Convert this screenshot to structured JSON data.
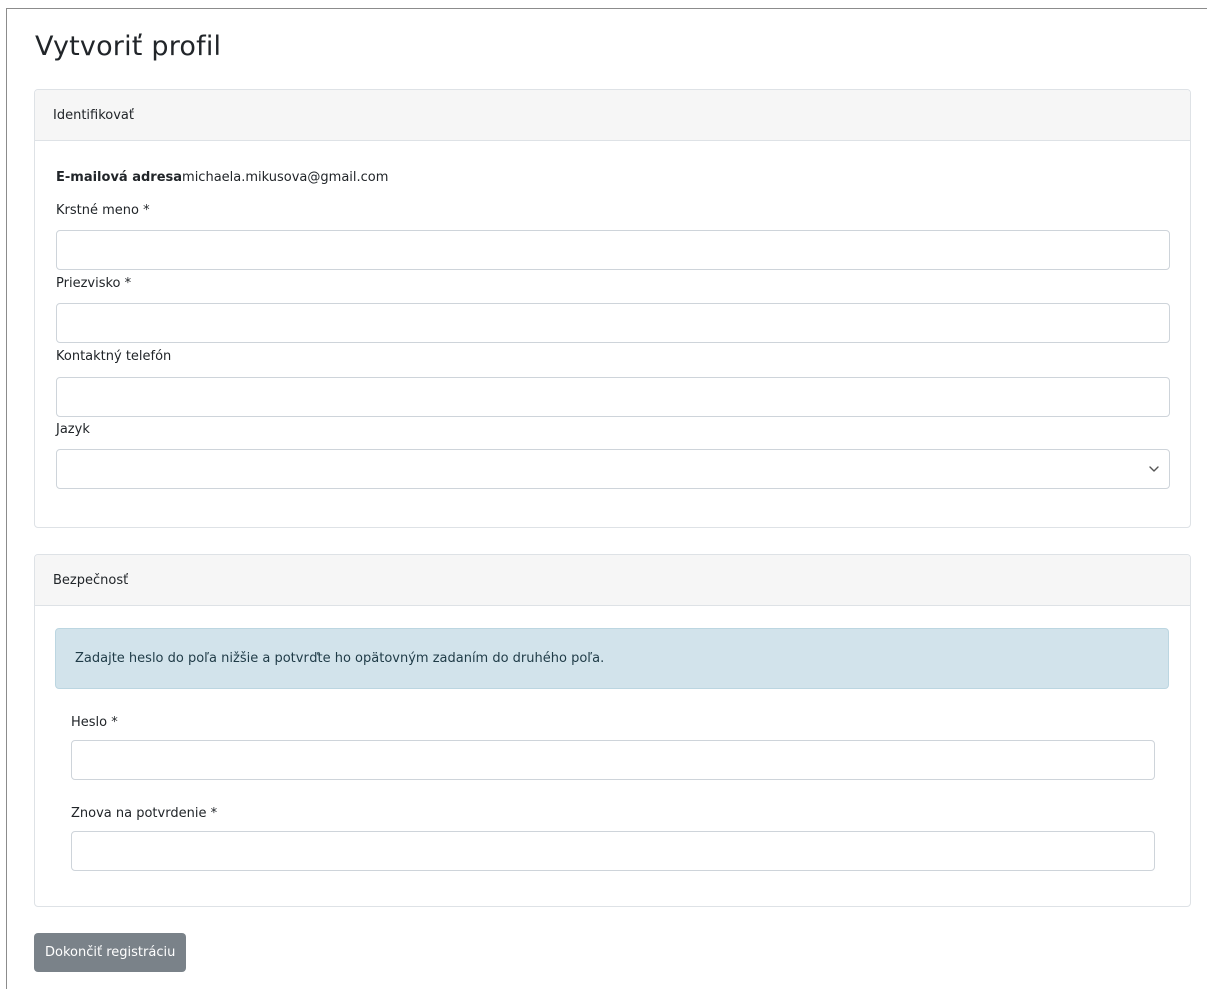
{
  "page": {
    "title": "Vytvoriť profil"
  },
  "identify": {
    "header": "Identifikovať",
    "email_label": "E-mailová adresa",
    "email_value": "michaela.mikusova@gmail.com",
    "first_name": {
      "label": "Krstné meno *",
      "value": ""
    },
    "last_name": {
      "label": "Priezvisko *",
      "value": ""
    },
    "phone": {
      "label": "Kontaktný telefón",
      "value": ""
    },
    "language": {
      "label": "Jazyk",
      "value": ""
    }
  },
  "security": {
    "header": "Bezpečnosť",
    "info": "Zadajte heslo do poľa nižšie a potvrďte ho opätovným zadaním do druhého poľa.",
    "password": {
      "label": "Heslo *",
      "value": ""
    },
    "confirm": {
      "label": "Znova na potvrdenie *",
      "value": ""
    }
  },
  "actions": {
    "submit_label": "Dokončiť registráciu"
  },
  "icons": {
    "select_arrow": "chevron-down-icon"
  },
  "colors": {
    "button_bg": "#6c757d",
    "alert_bg": "#d2e3eb",
    "card_header_bg": "#f6f6f6"
  }
}
